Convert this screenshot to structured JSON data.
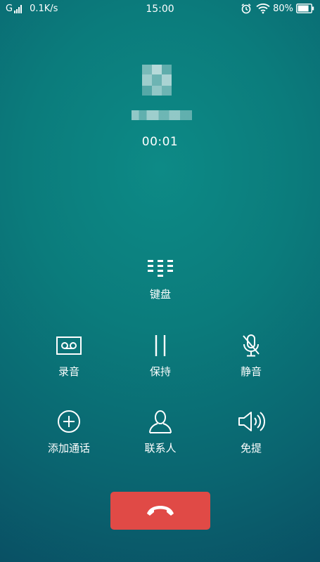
{
  "status_bar": {
    "network_type": "G",
    "speed": "0.1K/s",
    "time": "15:00",
    "battery": "80%",
    "icons": [
      "signal-icon",
      "alarm-icon",
      "wifi-icon",
      "battery-icon"
    ]
  },
  "call": {
    "caller_name_blurred": true,
    "duration": "00:01"
  },
  "actions": {
    "keypad": {
      "label": "键盘",
      "icon": "keypad-icon"
    },
    "record": {
      "label": "录音",
      "icon": "record-icon"
    },
    "hold": {
      "label": "保持",
      "icon": "pause-icon"
    },
    "mute": {
      "label": "静音",
      "icon": "mic-off-icon"
    },
    "add_call": {
      "label": "添加通话",
      "icon": "plus-circle-icon"
    },
    "contacts": {
      "label": "联系人",
      "icon": "person-icon"
    },
    "speaker": {
      "label": "免提",
      "icon": "speaker-icon"
    }
  },
  "end_call": {
    "icon": "hang-up-icon"
  },
  "colors": {
    "background_top": "#0d8a86",
    "background_bottom": "#094e63",
    "end_call": "#e04a46",
    "foreground": "#ffffff"
  }
}
